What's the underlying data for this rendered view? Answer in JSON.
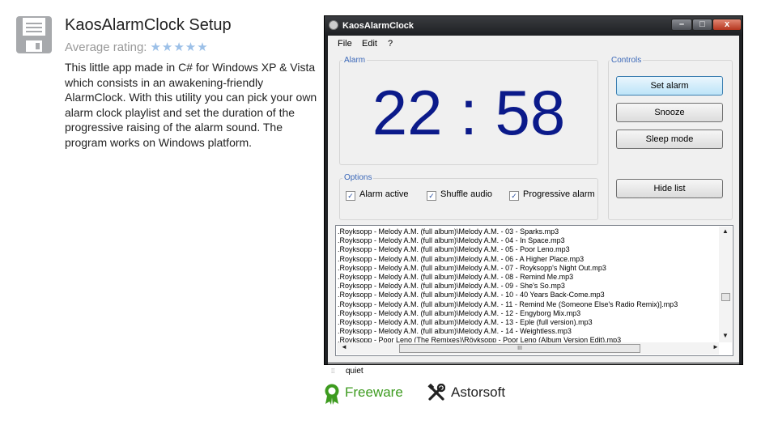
{
  "app": {
    "title": "KaosAlarmClock Setup",
    "rating_label": "Average rating:",
    "stars": "★★★★★",
    "description": "This little app made in C# for Windows XP & Vista which consists in an awakening-friendly AlarmClock. With this utility you can pick your own alarm clock playlist and set the duration of the progressive raising of the alarm sound. The program works on Windows platform."
  },
  "window": {
    "title": "KaosAlarmClock",
    "controls": {
      "minimize": "–",
      "maximize": "□",
      "close": "x"
    },
    "menu": [
      "File",
      "Edit",
      "?"
    ],
    "alarm_group": "Alarm",
    "clock": "22 : 58",
    "controls_group": "Controls",
    "buttons": {
      "set_alarm": "Set alarm",
      "snooze": "Snooze",
      "sleep_mode": "Sleep mode",
      "hide_list": "Hide list"
    },
    "options_group": "Options",
    "options": [
      {
        "label": "Alarm active",
        "checked": true
      },
      {
        "label": "Shuffle audio",
        "checked": true
      },
      {
        "label": "Progressive alarm",
        "checked": true
      }
    ],
    "playlist": [
      ".Royksopp - Melody A.M. (full album)\\Melody A.M. - 03 - Sparks.mp3",
      ".Royksopp - Melody A.M. (full album)\\Melody A.M. - 04 - In Space.mp3",
      ".Royksopp - Melody A.M. (full album)\\Melody A.M. - 05 - Poor Leno.mp3",
      ".Royksopp - Melody A.M. (full album)\\Melody A.M. - 06 - A Higher Place.mp3",
      ".Royksopp - Melody A.M. (full album)\\Melody A.M. - 07 - Royksopp's Night Out.mp3",
      ".Royksopp - Melody A.M. (full album)\\Melody A.M. - 08 - Remind Me.mp3",
      ".Royksopp - Melody A.M. (full album)\\Melody A.M. - 09 - She's So.mp3",
      ".Royksopp - Melody A.M. (full album)\\Melody A.M. - 10 - 40 Years Back-Come.mp3",
      ".Royksopp - Melody A.M. (full album)\\Melody A.M. - 11 - Remind Me (Someone Else's Radio Remix)].mp3",
      ".Royksopp - Melody A.M. (full album)\\Melody A.M. - 12 - Engyborg Mix.mp3",
      ".Royksopp - Melody A.M. (full album)\\Melody A.M. - 13 - Eple (full version).mp3",
      ".Royksopp - Melody A.M. (full album)\\Melody A.M. - 14 - Weightless.mp3",
      ".Royksopp - Poor Leno (The Remixes)\\Röyksopp - Poor Leno (Album Version Edit).mp3"
    ],
    "scroll": {
      "up": "▲",
      "down": "▼",
      "left": "◄",
      "right": "►",
      "grip": "III"
    },
    "status": "quiet",
    "status_grip": "⁞⁞"
  },
  "footer": {
    "license": "Freeware",
    "vendor": "Astorsoft"
  },
  "colors": {
    "clock": "#0b1a8a",
    "freeware": "#3d9b1f",
    "stars": "#9cc0e8"
  }
}
